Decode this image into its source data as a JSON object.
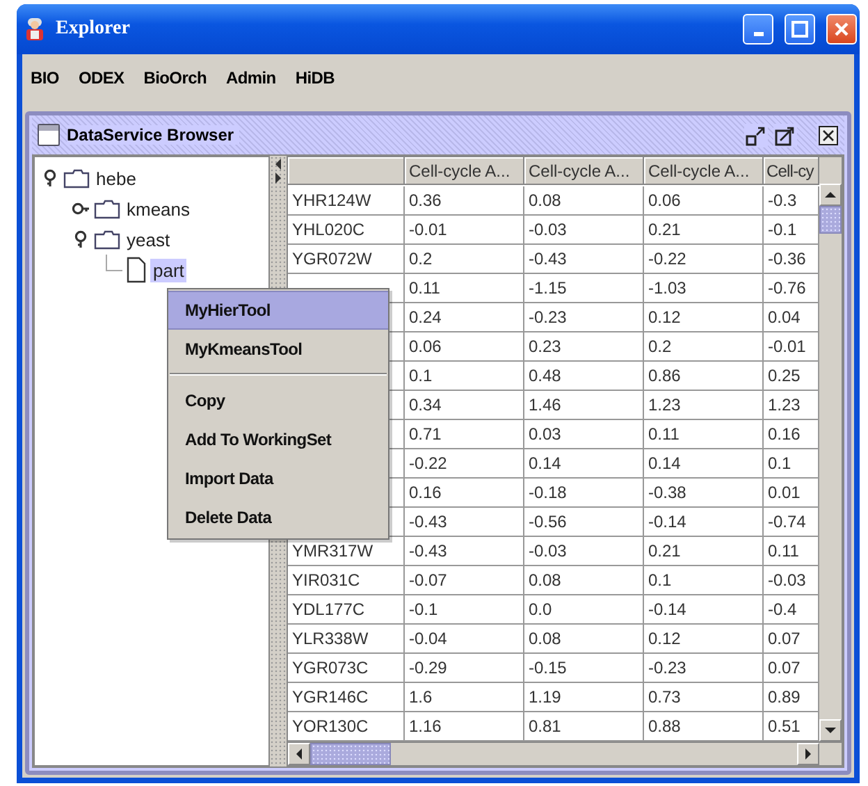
{
  "window": {
    "title": "Explorer"
  },
  "menu_bar": [
    "BIO",
    "ODEX",
    "BioOrch",
    "Admin",
    "HiDB"
  ],
  "internal_frame": {
    "title": "DataService Browser"
  },
  "tree": [
    {
      "label": "hebe",
      "expanded": true,
      "selected": false,
      "children": [
        {
          "label": "kmeans",
          "expanded": false,
          "selected": false
        },
        {
          "label": "yeast",
          "expanded": true,
          "selected": false,
          "children": [
            {
              "label": "part",
              "selected": true
            }
          ]
        }
      ]
    }
  ],
  "table": {
    "columns": [
      "Cell-cycle A...",
      "Cell-cycle A...",
      "Cell-cycle A...",
      "Cell-cy"
    ],
    "rows": [
      {
        "id": "YHR124W",
        "values": [
          "0.36",
          "0.08",
          "0.06",
          "-0.3"
        ]
      },
      {
        "id": "YHL020C",
        "values": [
          "-0.01",
          "-0.03",
          "0.21",
          "-0.1"
        ]
      },
      {
        "id": "YGR072W",
        "values": [
          "0.2",
          "-0.43",
          "-0.22",
          "-0.36"
        ]
      },
      {
        "values": [
          "0.11",
          "-1.15",
          "-1.03",
          "-0.76"
        ]
      },
      {
        "values": [
          "0.24",
          "-0.23",
          "0.12",
          "0.04"
        ]
      },
      {
        "values": [
          "0.06",
          "0.23",
          "0.2",
          "-0.01"
        ]
      },
      {
        "values": [
          "0.1",
          "0.48",
          "0.86",
          "0.25"
        ]
      },
      {
        "values": [
          "0.34",
          "1.46",
          "1.23",
          "1.23"
        ]
      },
      {
        "values": [
          "0.71",
          "0.03",
          "0.11",
          "0.16"
        ]
      },
      {
        "values": [
          "-0.22",
          "0.14",
          "0.14",
          "0.1"
        ]
      },
      {
        "values": [
          "0.16",
          "-0.18",
          "-0.38",
          "0.01"
        ]
      },
      {
        "values": [
          "-0.43",
          "-0.56",
          "-0.14",
          "-0.74"
        ]
      },
      {
        "id": "YMR317W",
        "values": [
          "-0.43",
          "-0.03",
          "0.21",
          "0.11"
        ]
      },
      {
        "id": "YIR031C",
        "values": [
          "-0.07",
          "0.08",
          "0.1",
          "-0.03"
        ]
      },
      {
        "id": "YDL177C",
        "values": [
          "-0.1",
          "0.0",
          "-0.14",
          "-0.4"
        ]
      },
      {
        "id": "YLR338W",
        "values": [
          "-0.04",
          "0.08",
          "0.12",
          "0.07"
        ]
      },
      {
        "id": "YGR073C",
        "values": [
          "-0.29",
          "-0.15",
          "-0.23",
          "0.07"
        ]
      },
      {
        "id": "YGR146C",
        "values": [
          "1.6",
          "1.19",
          "0.73",
          "0.89"
        ]
      },
      {
        "id": "YOR130C",
        "values": [
          "1.16",
          "0.81",
          "0.88",
          "0.51"
        ]
      }
    ]
  },
  "context_menu": {
    "groups": [
      [
        {
          "label": "MyHierTool",
          "selected": true
        },
        {
          "label": "MyKmeansTool",
          "selected": false
        }
      ],
      [
        {
          "label": "Copy",
          "selected": false
        },
        {
          "label": "Add To WorkingSet",
          "selected": false
        },
        {
          "label": "Import Data",
          "selected": false
        },
        {
          "label": "Delete Data",
          "selected": false
        }
      ]
    ]
  }
}
